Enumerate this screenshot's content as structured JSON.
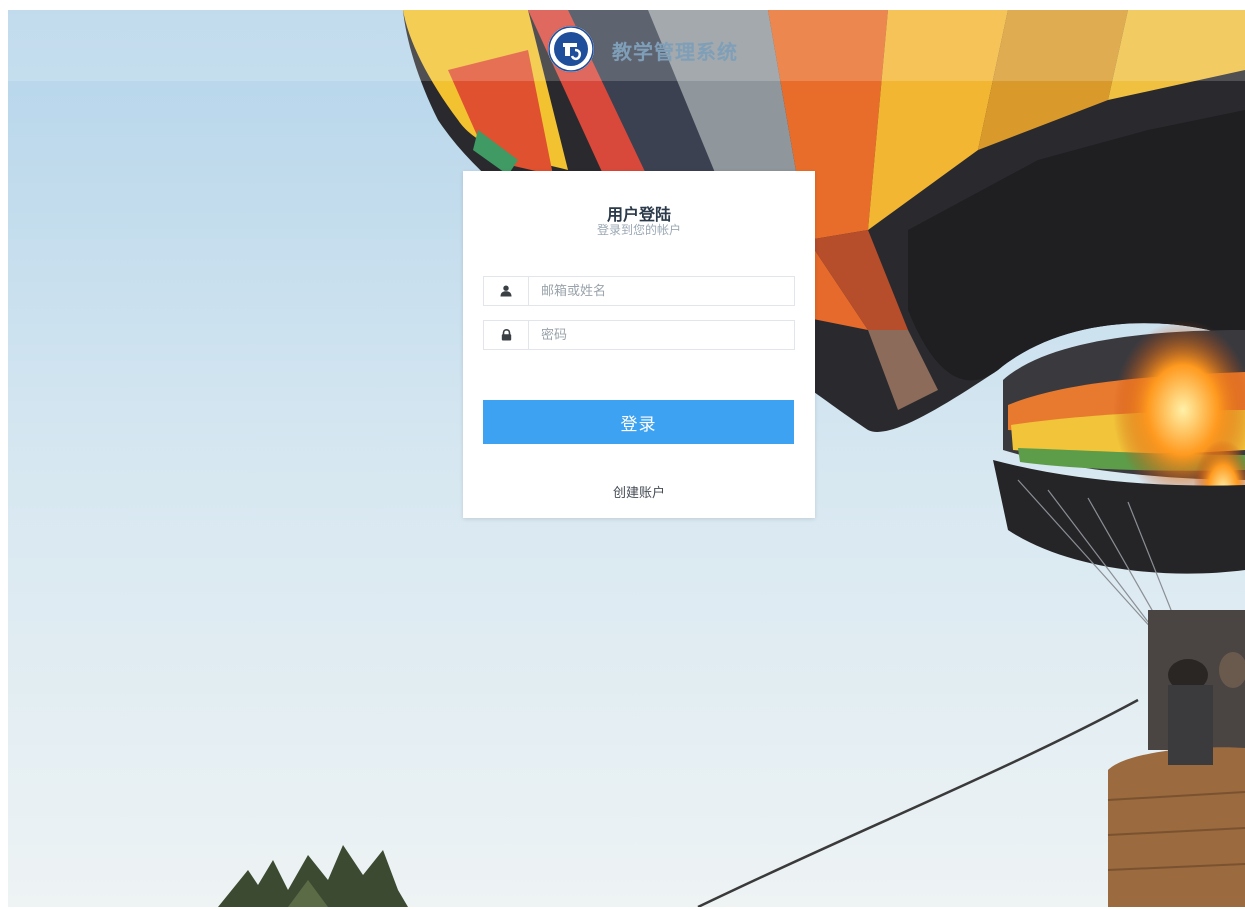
{
  "header": {
    "title": "教学管理系统"
  },
  "login": {
    "title": "用户登陆",
    "subtitle": "登录到您的帐户",
    "username_placeholder": "邮箱或姓名",
    "password_placeholder": "密码",
    "submit_label": "登录",
    "create_account_label": "创建账户"
  },
  "icons": {
    "user": "user-icon",
    "password": "lock-icon",
    "logo": "school-logo"
  },
  "colors": {
    "primary": "#3da2f1",
    "title_text": "#2b3a4a",
    "header_title": "#7f9fb8"
  }
}
